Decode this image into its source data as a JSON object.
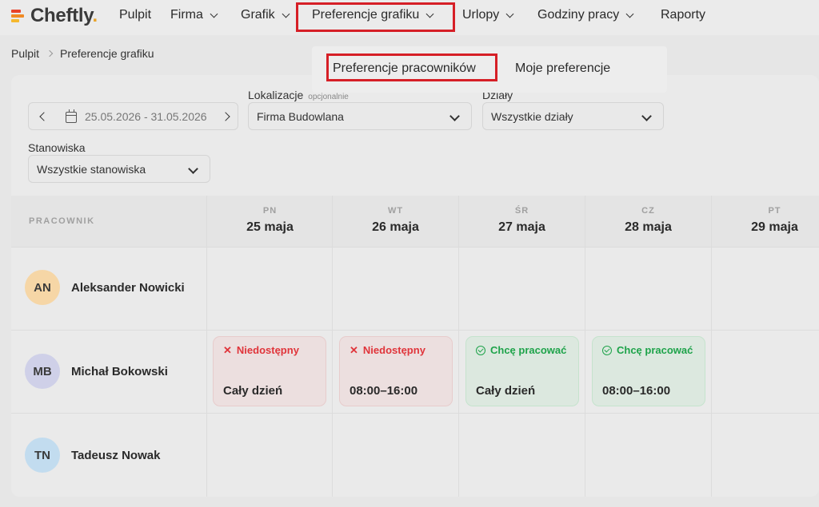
{
  "app": {
    "brand": "Cheftly",
    "brand_dot": ".",
    "logo_colors": [
      "#e8432a",
      "#f08a24",
      "#f5b82e",
      "#e8432a"
    ]
  },
  "nav": {
    "items": [
      {
        "label": "Pulpit",
        "has_dropdown": false
      },
      {
        "label": "Firma",
        "has_dropdown": true
      },
      {
        "label": "Grafik",
        "has_dropdown": true
      },
      {
        "label": "Preferencje grafiku",
        "has_dropdown": true,
        "highlighted": true
      },
      {
        "label": "Urlopy",
        "has_dropdown": true
      },
      {
        "label": "Godziny pracy",
        "has_dropdown": true
      },
      {
        "label": "Raporty",
        "has_dropdown": false
      }
    ],
    "highlight_color": "#d61f26"
  },
  "dropdown": {
    "items": [
      {
        "label": "Preferencje pracowników",
        "highlighted": true
      },
      {
        "label": "Moje preferencje",
        "highlighted": false
      }
    ]
  },
  "breadcrumb": {
    "items": [
      "Pulpit",
      "Preferencje grafiku"
    ]
  },
  "filters": {
    "date_range": "25.05.2026 - 31.05.2026",
    "location": {
      "label": "Lokalizacje",
      "sub": "opcjonalnie",
      "value": "Firma Budowlana"
    },
    "department": {
      "label": "Działy",
      "value": "Wszystkie działy"
    },
    "position": {
      "label": "Stanowiska",
      "value": "Wszystkie stanowiska"
    }
  },
  "grid": {
    "employee_header": "PRACOWNIK",
    "days": [
      {
        "abbr": "PN",
        "date": "25 maja"
      },
      {
        "abbr": "WT",
        "date": "26 maja"
      },
      {
        "abbr": "ŚR",
        "date": "27 maja"
      },
      {
        "abbr": "CZ",
        "date": "28 maja"
      },
      {
        "abbr": "PT",
        "date": "29 maja"
      }
    ],
    "employees": [
      {
        "initials": "AN",
        "name": "Aleksander Nowicki",
        "avatar_color": "#f6d6a6",
        "preferences": []
      },
      {
        "initials": "MB",
        "name": "Michał Bokowski",
        "avatar_color": "#cfd0e8",
        "preferences": [
          {
            "day": 0,
            "type": "neg",
            "status": "Niedostępny",
            "time": "Cały dzień"
          },
          {
            "day": 1,
            "type": "neg",
            "status": "Niedostępny",
            "time": "08:00–16:00"
          },
          {
            "day": 2,
            "type": "pos",
            "status": "Chcę pracować",
            "time": "Cały dzień"
          },
          {
            "day": 3,
            "type": "pos",
            "status": "Chcę pracować",
            "time": "08:00–16:00"
          }
        ]
      },
      {
        "initials": "TN",
        "name": "Tadeusz Nowak",
        "avatar_color": "#c2dcef",
        "preferences": []
      }
    ]
  }
}
